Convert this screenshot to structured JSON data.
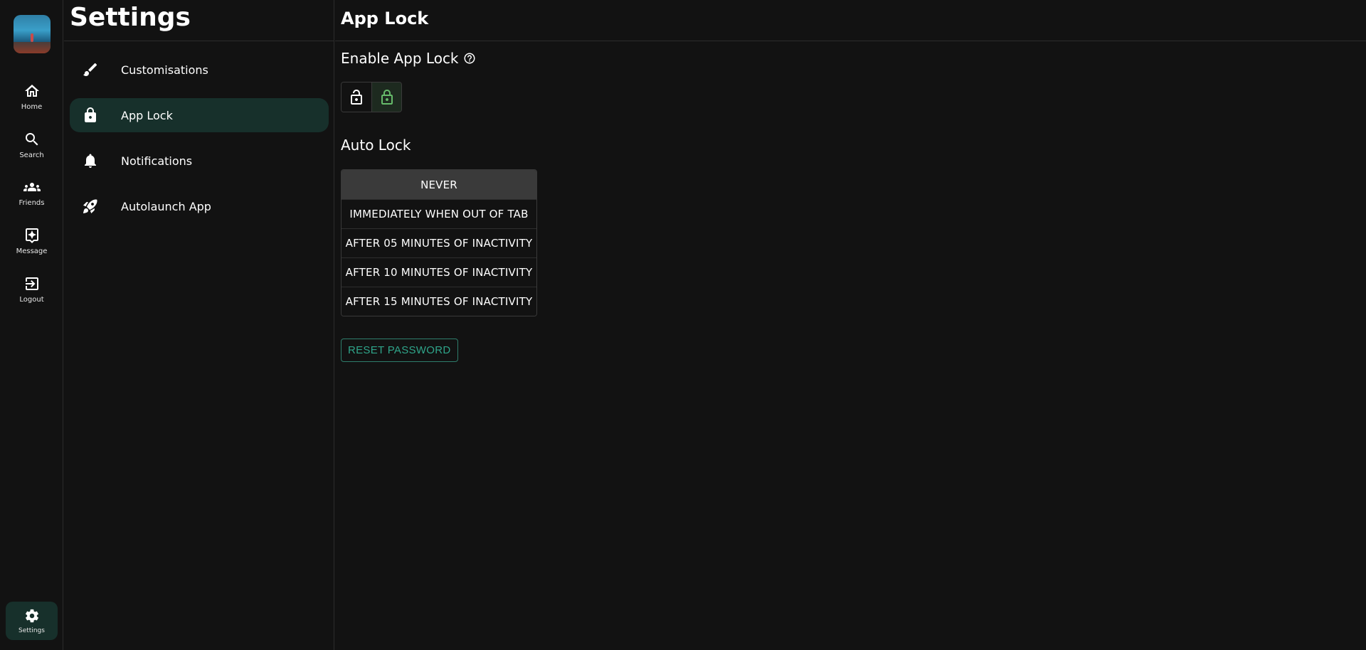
{
  "rail": {
    "items": [
      {
        "label": "Home",
        "icon": "home-icon"
      },
      {
        "label": "Search",
        "icon": "search-icon"
      },
      {
        "label": "Friends",
        "icon": "friends-icon"
      },
      {
        "label": "Message",
        "icon": "message-icon"
      },
      {
        "label": "Logout",
        "icon": "logout-icon"
      }
    ],
    "settings_label": "Settings"
  },
  "menu": {
    "title": "Settings",
    "items": [
      {
        "label": "Customisations",
        "icon": "brush-icon"
      },
      {
        "label": "App Lock",
        "icon": "lock-icon",
        "active": true
      },
      {
        "label": "Notifications",
        "icon": "bell-icon"
      },
      {
        "label": "Autolaunch App",
        "icon": "rocket-icon"
      }
    ]
  },
  "content": {
    "title": "App Lock",
    "enable_label": "Enable App Lock",
    "enable_state": "locked",
    "auto_lock_label": "Auto Lock",
    "auto_lock_options": [
      "NEVER",
      "IMMEDIATELY WHEN OUT OF TAB",
      "AFTER 05 MINUTES OF INACTIVITY",
      "AFTER 10 MINUTES OF INACTIVITY",
      "AFTER 15 MINUTES OF INACTIVITY"
    ],
    "auto_lock_selected": "NEVER",
    "reset_label": "RESET PASSWORD"
  },
  "colors": {
    "background": "#121212",
    "accent_active": "#17302b",
    "lock_green": "#66bb6a",
    "reset_teal": "#2fa58a"
  }
}
